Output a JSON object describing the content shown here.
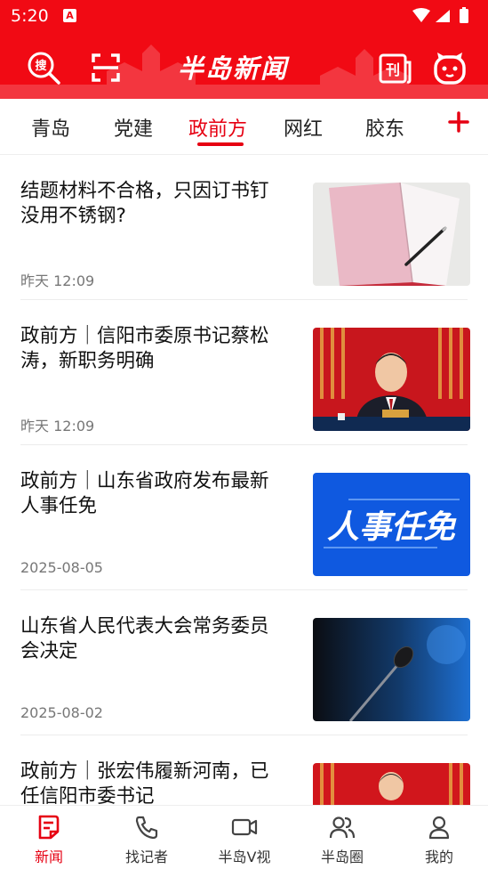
{
  "status_bar": {
    "time": "5:20",
    "notification_icon_letter": "A"
  },
  "header": {
    "brand": "半岛新闻",
    "left_icons": [
      "search-icon",
      "scan-icon"
    ],
    "right_icons": [
      "newspaper-icon",
      "mascot-icon"
    ],
    "accent_color": "#f10a14"
  },
  "tabs": [
    {
      "label": "青岛",
      "active": false
    },
    {
      "label": "党建",
      "active": false
    },
    {
      "label": "政前方",
      "active": true
    },
    {
      "label": "网红",
      "active": false
    },
    {
      "label": "胶东",
      "active": false
    }
  ],
  "news": [
    {
      "title": "结题材料不合格，只因订书钉没用不锈钢?",
      "time": "昨天 12:09",
      "thumb": "notebook-pen"
    },
    {
      "title": "政前方｜信阳市委原书记蔡松涛，新职务明确",
      "time": "昨天 12:09",
      "thumb": "official-portrait"
    },
    {
      "title": "政前方｜山东省政府发布最新人事任免",
      "time": "2025-08-05",
      "thumb": "personnel-banner",
      "thumb_text": "人事任免"
    },
    {
      "title": "山东省人民代表大会常务委员会决定",
      "time": "2025-08-02",
      "thumb": "microphone"
    },
    {
      "title": "政前方｜张宏伟履新河南，已任信阳市委书记",
      "time": "",
      "thumb": "official-portrait-2"
    }
  ],
  "bottom_nav": [
    {
      "label": "新闻",
      "icon": "news-icon",
      "active": true
    },
    {
      "label": "找记者",
      "icon": "phone-icon",
      "active": false
    },
    {
      "label": "半岛V视",
      "icon": "video-icon",
      "active": false
    },
    {
      "label": "半岛圈",
      "icon": "people-icon",
      "active": false
    },
    {
      "label": "我的",
      "icon": "profile-icon",
      "active": false
    }
  ]
}
